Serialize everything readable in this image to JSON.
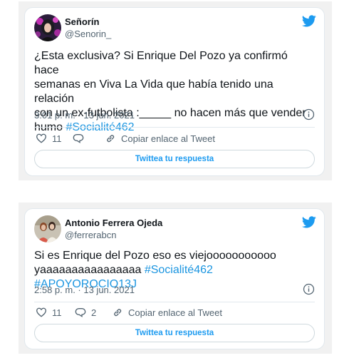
{
  "tweets": [
    {
      "display_name": "Señorín",
      "handle": "@Senorin_",
      "text_plain": "¿Esta exclusiva? Si Enrique Del Pozo ya confirmó hace\nsemanas en Viva La Vida que había tenido una relación\ncon un ex-futbolista :_____ no hacen más que vender\nhumo ",
      "hashtags": [
        "#Socialité462"
      ],
      "timestamp": "3:01 p. m. · 13 jun. 2021",
      "likes": "11",
      "replies": "",
      "copy_link_label": "Copiar enlace al Tweet",
      "reply_cta": "Twittea tu respuesta"
    },
    {
      "display_name": "Antonio Ferrera Ojeda",
      "handle": "@ferrerabcn",
      "text_plain": "Si es Enrique del Pozo eso es viejooooooooooo\nyaaaaaaaaaaaaaaaa ",
      "hashtags": [
        "#Socialité462",
        "#APOYOROCIO13J"
      ],
      "timestamp": "2:58 p. m. · 13 jun. 2021",
      "likes": "11",
      "replies": "2",
      "copy_link_label": "Copiar enlace al Tweet",
      "reply_cta": "Twittea tu respuesta"
    }
  ],
  "icons": {
    "brand": "twitter-bird-icon",
    "info": "info-icon",
    "like": "heart-icon",
    "reply": "reply-bubble-icon",
    "copy": "link-icon"
  },
  "colors": {
    "brand_blue": "#1d9bf0",
    "hashtag_blue": "#1b95e0",
    "text_primary": "#0f1419",
    "text_secondary": "#536471",
    "frame_background": "#f1f1f1"
  }
}
